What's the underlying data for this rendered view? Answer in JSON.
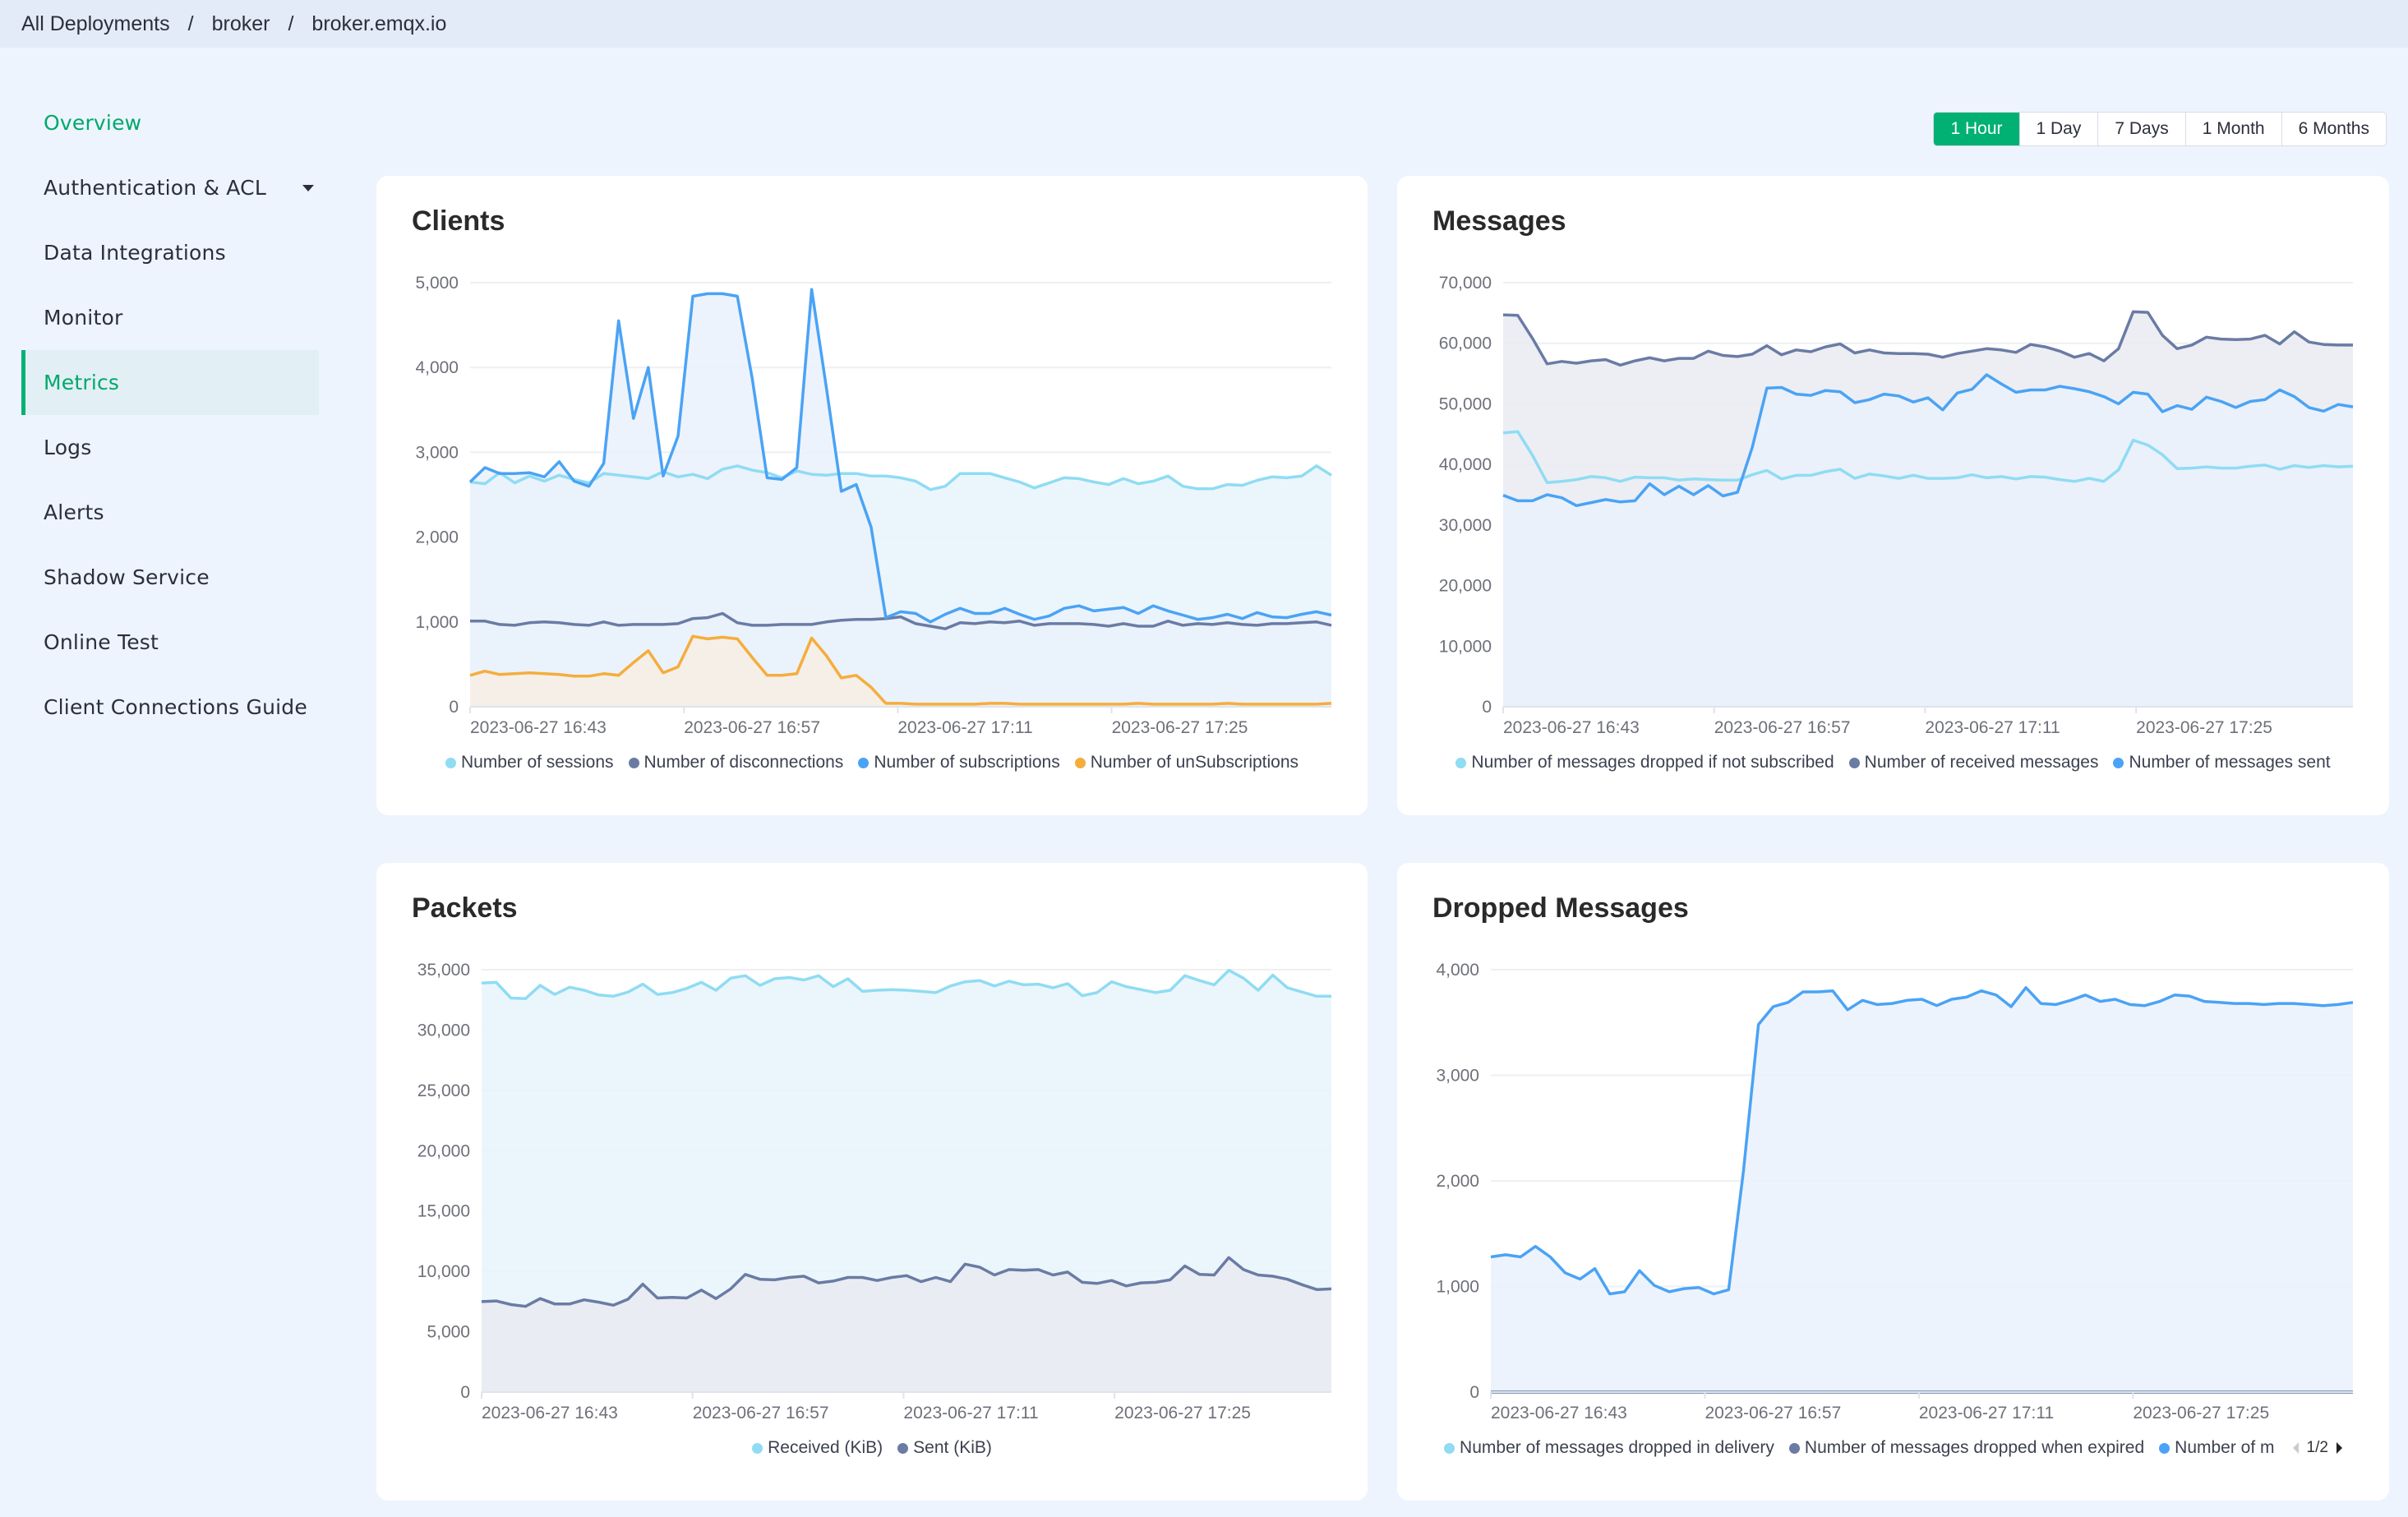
{
  "breadcrumb": [
    "All Deployments",
    "broker",
    "broker.emqx.io"
  ],
  "breadcrumb_separator": "/",
  "sidebar": {
    "items": [
      {
        "label": "Overview",
        "state": "highlighted"
      },
      {
        "label": "Authentication & ACL",
        "has_dropdown": true
      },
      {
        "label": "Data Integrations"
      },
      {
        "label": "Monitor"
      },
      {
        "label": "Metrics",
        "state": "active"
      },
      {
        "label": "Logs"
      },
      {
        "label": "Alerts"
      },
      {
        "label": "Shadow Service"
      },
      {
        "label": "Online Test"
      },
      {
        "label": "Client Connections Guide"
      }
    ]
  },
  "time_range": {
    "options": [
      "1 Hour",
      "1 Day",
      "7 Days",
      "1 Month",
      "6 Months"
    ],
    "selected": "1 Hour"
  },
  "colors": {
    "accent": "#00b173",
    "series_cyan": "#8fdcf3",
    "series_slate": "#6a7ba4",
    "series_blue": "#4aa3f5",
    "series_orange": "#f5ad3c"
  },
  "chart_data": [
    {
      "id": "clients",
      "type": "area",
      "title": "Clients",
      "ylim": [
        0,
        5000
      ],
      "yticks": [
        0,
        1000,
        2000,
        3000,
        4000,
        5000
      ],
      "xtick_labels": [
        "2023-06-27 16:43",
        "2023-06-27 16:57",
        "2023-06-27 17:11",
        "2023-06-27 17:25"
      ],
      "legend": "bottom",
      "grid": true,
      "series": [
        {
          "name": "Number of sessions",
          "color": "#8fdcf3",
          "fill": "#e8f4fb",
          "values": [
            2650,
            2630,
            2760,
            2640,
            2720,
            2660,
            2730,
            2680,
            2640,
            2750,
            2730,
            2710,
            2690,
            2770,
            2710,
            2740,
            2690,
            2800,
            2840,
            2790,
            2760,
            2700,
            2780,
            2740,
            2730,
            2750,
            2750,
            2720,
            2720,
            2700,
            2660,
            2560,
            2600,
            2750,
            2750,
            2750,
            2700,
            2650,
            2580,
            2640,
            2700,
            2690,
            2650,
            2620,
            2690,
            2630,
            2660,
            2720,
            2600,
            2570,
            2570,
            2620,
            2610,
            2670,
            2710,
            2700,
            2720,
            2840,
            2730
          ]
        },
        {
          "name": "Number of disconnections",
          "color": "#6a7ba4",
          "fill": null,
          "values": [
            1010,
            1010,
            970,
            960,
            990,
            1000,
            990,
            970,
            960,
            1000,
            960,
            970,
            970,
            970,
            980,
            1040,
            1050,
            1100,
            990,
            960,
            960,
            970,
            970,
            970,
            1000,
            1020,
            1030,
            1030,
            1040,
            1060,
            980,
            950,
            920,
            990,
            980,
            1000,
            990,
            1010,
            960,
            980,
            980,
            980,
            970,
            950,
            980,
            950,
            950,
            1010,
            960,
            980,
            970,
            990,
            970,
            960,
            980,
            980,
            990,
            1000,
            960
          ]
        },
        {
          "name": "Number of subscriptions",
          "color": "#4aa3f5",
          "fill": "#eaf1fc",
          "values": [
            2650,
            2820,
            2750,
            2750,
            2760,
            2710,
            2890,
            2660,
            2600,
            2870,
            4550,
            3400,
            4000,
            2720,
            3190,
            4840,
            4870,
            4870,
            4840,
            3870,
            2700,
            2680,
            2820,
            4920,
            3750,
            2540,
            2620,
            2120,
            1050,
            1120,
            1100,
            1000,
            1090,
            1160,
            1100,
            1100,
            1160,
            1090,
            1030,
            1070,
            1160,
            1190,
            1130,
            1150,
            1170,
            1100,
            1190,
            1130,
            1080,
            1030,
            1050,
            1090,
            1040,
            1110,
            1060,
            1050,
            1090,
            1120,
            1080
          ]
        },
        {
          "name": "Number of unSubscriptions",
          "color": "#f5ad3c",
          "fill": "#f7efe4",
          "values": [
            370,
            420,
            380,
            390,
            400,
            390,
            380,
            360,
            360,
            390,
            370,
            520,
            660,
            400,
            470,
            830,
            800,
            820,
            800,
            580,
            370,
            370,
            390,
            810,
            600,
            340,
            370,
            230,
            40,
            40,
            30,
            30,
            30,
            30,
            30,
            40,
            40,
            30,
            30,
            30,
            30,
            30,
            30,
            30,
            30,
            40,
            30,
            30,
            30,
            30,
            30,
            40,
            30,
            30,
            30,
            30,
            30,
            30,
            40
          ]
        }
      ]
    },
    {
      "id": "messages",
      "type": "area",
      "title": "Messages",
      "ylim": [
        0,
        70000
      ],
      "yticks": [
        0,
        10000,
        20000,
        30000,
        40000,
        50000,
        60000,
        70000
      ],
      "xtick_labels": [
        "2023-06-27 16:43",
        "2023-06-27 16:57",
        "2023-06-27 17:11",
        "2023-06-27 17:25"
      ],
      "legend": "bottom",
      "grid": true,
      "series": [
        {
          "name": "Number of messages dropped if not subscribed",
          "color": "#8fdcf3",
          "fill": null,
          "values": [
            45200,
            45400,
            41500,
            37000,
            37200,
            37500,
            38000,
            37800,
            37200,
            37900,
            37800,
            37800,
            37400,
            37600,
            37500,
            37400,
            37400,
            38300,
            39000,
            37600,
            38200,
            38200,
            38800,
            39200,
            37700,
            38400,
            38100,
            37700,
            38200,
            37700,
            37700,
            37800,
            38300,
            37800,
            38000,
            37600,
            38000,
            37900,
            37500,
            37200,
            37700,
            37200,
            39100,
            44000,
            43200,
            41600,
            39300,
            39400,
            39600,
            39400,
            39400,
            39700,
            39900,
            39200,
            39800,
            39500,
            39800,
            39600,
            39700
          ]
        },
        {
          "name": "Number of received messages",
          "color": "#6a7ba4",
          "fill": "#e9ebf1",
          "values": [
            64700,
            64600,
            60800,
            56600,
            57000,
            56700,
            57100,
            57300,
            56400,
            57100,
            57600,
            57100,
            57500,
            57500,
            58700,
            58000,
            57800,
            58200,
            59600,
            58100,
            58900,
            58600,
            59400,
            59900,
            58400,
            58900,
            58400,
            58300,
            58300,
            58200,
            57700,
            58300,
            58700,
            59100,
            58900,
            58500,
            59800,
            59400,
            58700,
            57700,
            58300,
            57100,
            59100,
            65200,
            65100,
            61300,
            59100,
            59700,
            61000,
            60700,
            60600,
            60700,
            61300,
            59900,
            61900,
            60200,
            59800,
            59700,
            59700
          ]
        },
        {
          "name": "Number of messages sent",
          "color": "#4aa3f5",
          "fill": "#eaf1fc",
          "values": [
            34900,
            34000,
            34000,
            35000,
            34500,
            33200,
            33700,
            34200,
            33800,
            34000,
            36800,
            35000,
            36400,
            35000,
            36500,
            34800,
            35400,
            42800,
            52600,
            52700,
            51600,
            51400,
            52200,
            52000,
            50200,
            50700,
            51600,
            51300,
            50300,
            51000,
            49000,
            51800,
            52400,
            54800,
            53300,
            51900,
            52300,
            52300,
            52900,
            52500,
            52000,
            51200,
            50000,
            51900,
            51600,
            48700,
            49700,
            49100,
            51100,
            50400,
            49400,
            50400,
            50700,
            52300,
            51200,
            49400,
            48800,
            49900,
            49500
          ]
        }
      ]
    },
    {
      "id": "packets",
      "type": "area",
      "title": "Packets",
      "ylim": [
        0,
        35000
      ],
      "yticks": [
        0,
        5000,
        10000,
        15000,
        20000,
        25000,
        30000,
        35000
      ],
      "xtick_labels": [
        "2023-06-27 16:43",
        "2023-06-27 16:57",
        "2023-06-27 17:11",
        "2023-06-27 17:25"
      ],
      "legend": "bottom",
      "grid": true,
      "series": [
        {
          "name": "Received (KiB)",
          "color": "#8fdcf3",
          "fill": "#e8f4fb",
          "values": [
            33900,
            33950,
            32650,
            32600,
            33700,
            32950,
            33550,
            33300,
            32900,
            32800,
            33150,
            33800,
            32950,
            33100,
            33450,
            33950,
            33300,
            34300,
            34500,
            33700,
            34250,
            34350,
            34150,
            34500,
            33600,
            34250,
            33200,
            33300,
            33350,
            33300,
            33200,
            33100,
            33650,
            34000,
            34100,
            33650,
            34050,
            33750,
            33800,
            33500,
            33850,
            32850,
            33100,
            34000,
            33600,
            33350,
            33100,
            33300,
            34500,
            34100,
            33750,
            34950,
            34300,
            33300,
            34550,
            33500,
            33150,
            32800,
            32800
          ]
        },
        {
          "name": "Sent (KiB)",
          "color": "#6a7ba4",
          "fill": "#e9ebf1",
          "values": [
            7500,
            7550,
            7250,
            7100,
            7750,
            7300,
            7300,
            7650,
            7450,
            7200,
            7700,
            8950,
            7800,
            7850,
            7800,
            8450,
            7750,
            8550,
            9750,
            9350,
            9300,
            9500,
            9600,
            9050,
            9200,
            9500,
            9500,
            9250,
            9500,
            9650,
            9150,
            9500,
            9150,
            10600,
            10350,
            9700,
            10150,
            10100,
            10150,
            9700,
            9950,
            9100,
            9000,
            9250,
            8800,
            9050,
            9100,
            9300,
            10450,
            9750,
            9700,
            11150,
            10150,
            9700,
            9600,
            9350,
            8900,
            8500,
            8550
          ]
        }
      ]
    },
    {
      "id": "dropped",
      "type": "area",
      "title": "Dropped Messages",
      "ylim": [
        0,
        4000
      ],
      "yticks": [
        0,
        1000,
        2000,
        3000,
        4000
      ],
      "xtick_labels": [
        "2023-06-27 16:43",
        "2023-06-27 16:57",
        "2023-06-27 17:11",
        "2023-06-27 17:25"
      ],
      "legend": "bottom",
      "legend_page": "1/2",
      "grid": true,
      "series": [
        {
          "name": "Number of messages dropped in delivery",
          "color": "#8fdcf3",
          "fill": null,
          "values": [
            0,
            0,
            0,
            0,
            0,
            0,
            0,
            0,
            0,
            0,
            0,
            0,
            0,
            0,
            0,
            0,
            0,
            0,
            0,
            0,
            0,
            0,
            0,
            0,
            0,
            0,
            0,
            0,
            0,
            0,
            0,
            0,
            0,
            0,
            0,
            0,
            0,
            0,
            0,
            0,
            0,
            0,
            0,
            0,
            0,
            0,
            0,
            0,
            0,
            0,
            0,
            0,
            0,
            0,
            0,
            0,
            0,
            0,
            0
          ]
        },
        {
          "name": "Number of messages dropped when expired",
          "color": "#6a7ba4",
          "fill": null,
          "values": [
            0,
            0,
            0,
            0,
            0,
            0,
            0,
            0,
            0,
            0,
            0,
            0,
            0,
            0,
            0,
            0,
            0,
            0,
            0,
            0,
            0,
            0,
            0,
            0,
            0,
            0,
            0,
            0,
            0,
            0,
            0,
            0,
            0,
            0,
            0,
            0,
            0,
            0,
            0,
            0,
            0,
            0,
            0,
            0,
            0,
            0,
            0,
            0,
            0,
            0,
            0,
            0,
            0,
            0,
            0,
            0,
            0,
            0,
            0
          ]
        },
        {
          "name": "Number of messages dropped...",
          "legend_visible_text": "Number of m",
          "color": "#4aa3f5",
          "fill": "#eaf1fc",
          "values": [
            1280,
            1300,
            1280,
            1380,
            1280,
            1130,
            1070,
            1170,
            930,
            950,
            1150,
            1010,
            950,
            980,
            990,
            930,
            970,
            2100,
            3480,
            3650,
            3690,
            3790,
            3790,
            3800,
            3620,
            3710,
            3670,
            3680,
            3710,
            3720,
            3660,
            3720,
            3740,
            3800,
            3760,
            3650,
            3830,
            3680,
            3670,
            3710,
            3760,
            3700,
            3720,
            3670,
            3660,
            3700,
            3760,
            3750,
            3700,
            3690,
            3680,
            3680,
            3670,
            3680,
            3680,
            3670,
            3660,
            3670,
            3690
          ]
        }
      ]
    }
  ]
}
